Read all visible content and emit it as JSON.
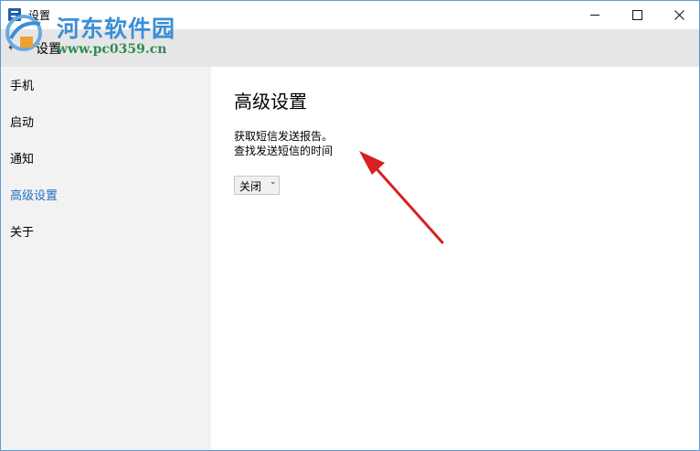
{
  "window": {
    "title": "设置",
    "controls": {
      "minimize": "minimize-icon",
      "maximize": "maximize-icon",
      "close": "close-icon"
    }
  },
  "header": {
    "title": "设置",
    "back_icon": "back-arrow-icon"
  },
  "sidebar": {
    "items": [
      {
        "label": "手机",
        "active": false
      },
      {
        "label": "启动",
        "active": false
      },
      {
        "label": "通知",
        "active": false
      },
      {
        "label": "高级设置",
        "active": true
      },
      {
        "label": "关于",
        "active": false
      }
    ]
  },
  "main": {
    "title": "高级设置",
    "description_line1": "获取短信发送报告。",
    "description_line2": "查找发送短信的时间",
    "dropdown": {
      "selected": "关闭",
      "chevron": "chevron-down-icon"
    }
  },
  "watermark": {
    "name": "河东软件园",
    "url": "www.pc0359.cn"
  },
  "colors": {
    "accent": "#1f6fbf",
    "sidebar_bg": "#f2f2f2",
    "header_bg": "#e6e6e6",
    "annotation_arrow": "#d9201f",
    "watermark_text": "#3a8fd6",
    "watermark_url": "#2e8b57"
  }
}
